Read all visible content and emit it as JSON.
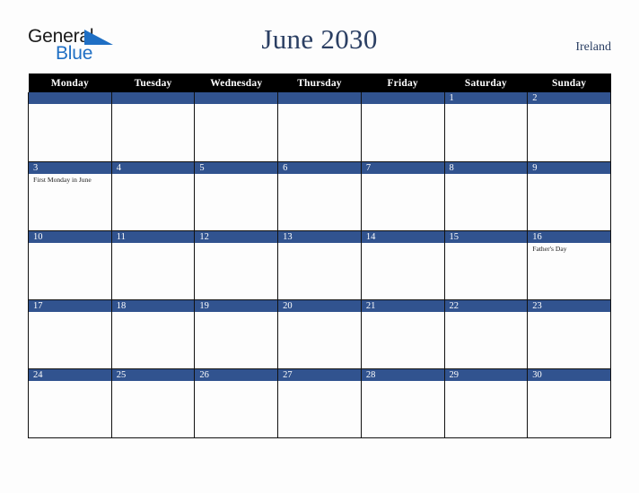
{
  "brand": {
    "name_part1": "General",
    "name_part2": "Blue",
    "triangle_color": "#1f6fc4",
    "text_color": "#1a1a1a"
  },
  "header": {
    "title": "June 2030",
    "country": "Ireland",
    "title_color": "#2b3f63"
  },
  "theme": {
    "accent_blue": "#31538f",
    "header_row_bg": "#000000",
    "page_bg": "#fdfdfd",
    "cell_bg": "#fdfdfd",
    "grid_line": "#111111"
  },
  "calendar": {
    "month": "June",
    "year": "2030",
    "weekday_headers": [
      "Monday",
      "Tuesday",
      "Wednesday",
      "Thursday",
      "Friday",
      "Saturday",
      "Sunday"
    ],
    "weeks": [
      [
        {
          "day": "",
          "events": []
        },
        {
          "day": "",
          "events": []
        },
        {
          "day": "",
          "events": []
        },
        {
          "day": "",
          "events": []
        },
        {
          "day": "",
          "events": []
        },
        {
          "day": "1",
          "events": []
        },
        {
          "day": "2",
          "events": []
        }
      ],
      [
        {
          "day": "3",
          "events": [
            "First Monday in June"
          ]
        },
        {
          "day": "4",
          "events": []
        },
        {
          "day": "5",
          "events": []
        },
        {
          "day": "6",
          "events": []
        },
        {
          "day": "7",
          "events": []
        },
        {
          "day": "8",
          "events": []
        },
        {
          "day": "9",
          "events": []
        }
      ],
      [
        {
          "day": "10",
          "events": []
        },
        {
          "day": "11",
          "events": []
        },
        {
          "day": "12",
          "events": []
        },
        {
          "day": "13",
          "events": []
        },
        {
          "day": "14",
          "events": []
        },
        {
          "day": "15",
          "events": []
        },
        {
          "day": "16",
          "events": [
            "Father's Day"
          ]
        }
      ],
      [
        {
          "day": "17",
          "events": []
        },
        {
          "day": "18",
          "events": []
        },
        {
          "day": "19",
          "events": []
        },
        {
          "day": "20",
          "events": []
        },
        {
          "day": "21",
          "events": []
        },
        {
          "day": "22",
          "events": []
        },
        {
          "day": "23",
          "events": []
        }
      ],
      [
        {
          "day": "24",
          "events": []
        },
        {
          "day": "25",
          "events": []
        },
        {
          "day": "26",
          "events": []
        },
        {
          "day": "27",
          "events": []
        },
        {
          "day": "28",
          "events": []
        },
        {
          "day": "29",
          "events": []
        },
        {
          "day": "30",
          "events": []
        }
      ]
    ]
  }
}
